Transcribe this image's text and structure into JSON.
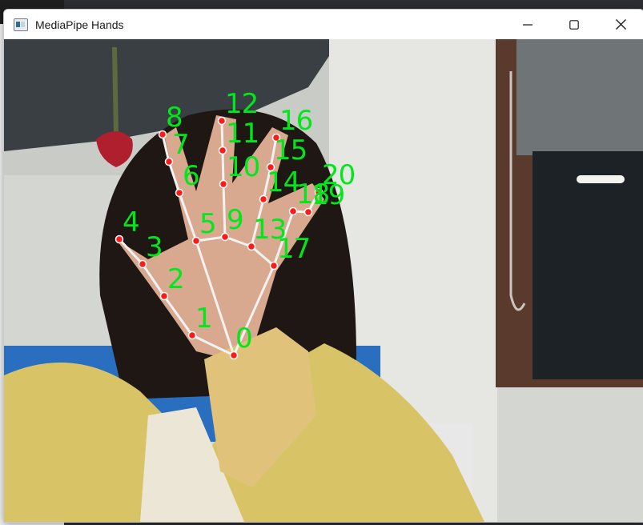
{
  "window": {
    "title": "MediaPipe Hands",
    "app_icon": "app-window-icon",
    "controls": [
      "minimize-icon",
      "maximize-icon",
      "close-icon"
    ]
  },
  "hand": {
    "landmark_color": "#ff1a1a",
    "connection_color": "#f2f2f2",
    "label_color": "#00e81c",
    "landmarks": [
      {
        "id": "0"
      },
      {
        "id": "1"
      },
      {
        "id": "2"
      },
      {
        "id": "3"
      },
      {
        "id": "4"
      },
      {
        "id": "5"
      },
      {
        "id": "6"
      },
      {
        "id": "7"
      },
      {
        "id": "8"
      },
      {
        "id": "9"
      },
      {
        "id": "10"
      },
      {
        "id": "11"
      },
      {
        "id": "12"
      },
      {
        "id": "13"
      },
      {
        "id": "14"
      },
      {
        "id": "15"
      },
      {
        "id": "16"
      },
      {
        "id": "17"
      },
      {
        "id": "18"
      },
      {
        "id": "19"
      },
      {
        "id": "20"
      }
    ]
  }
}
